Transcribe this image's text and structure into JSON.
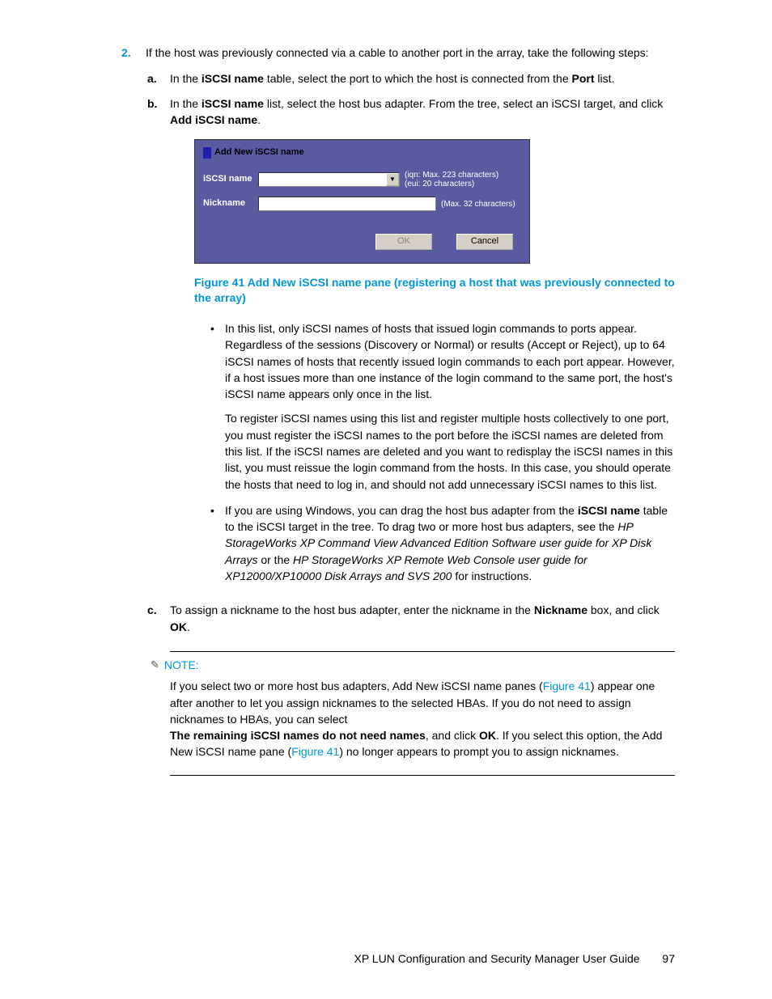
{
  "step2": {
    "num": "2.",
    "intro_a": "If the host was previously connected via a cable to another port in the array, take the following steps:",
    "a": {
      "letter": "a.",
      "t1": "In the ",
      "b1": "iSCSI name",
      "t2": " table, select the port to which the host is connected from the ",
      "b2": "Port",
      "t3": " list."
    },
    "b": {
      "letter": "b.",
      "t1": "In the ",
      "b1": "iSCSI name",
      "t2": " list, select the host bus adapter. From the tree, select an iSCSI target, and click ",
      "b2": "Add iSCSI name",
      "t3": "."
    },
    "c": {
      "letter": "c.",
      "t1": "To assign a nickname to the host bus adapter, enter the nickname in the ",
      "b1": "Nickname",
      "t2": " box, and click ",
      "b2": "OK",
      "t3": "."
    }
  },
  "dialog": {
    "title": "Add New iSCSI name",
    "label_iscsi": "iSCSI name",
    "hint_iscsi_line1": "(iqn: Max. 223 characters)",
    "hint_iscsi_line2": "(eui: 20 characters)",
    "label_nick": "Nickname",
    "hint_nick": "(Max. 32 characters)",
    "btn_ok": "OK",
    "btn_cancel": "Cancel"
  },
  "figcap": "Figure 41 Add New iSCSI name pane (registering a host that was previously connected to the array)",
  "bullets": {
    "b1p1": "In this list, only iSCSI names of hosts that issued login commands to ports appear. Regardless of the sessions (Discovery or Normal) or results (Accept or Reject), up to 64 iSCSI names of hosts that recently issued login commands to each port appear. However, if a host issues more than one instance of the login command to the same port, the host's iSCSI name appears only once in the list.",
    "b1p2": "To register iSCSI names using this list and register multiple hosts collectively to one port, you must register the iSCSI names to the port before the iSCSI names are deleted from this list. If the iSCSI names are deleted and you want to redisplay the iSCSI names in this list, you must reissue the login command from the hosts. In this case, you should operate the hosts that need to log in, and should not add unnecessary iSCSI names to this list.",
    "b2": {
      "t1": "If you are using Windows, you can drag the host bus adapter from the ",
      "b1": "iSCSI name",
      "t2": " table to the iSCSI target in the tree. To drag two or more host bus adapters, see the ",
      "i1": "HP StorageWorks XP Command View Advanced Edition Software user guide for XP Disk Arrays",
      "t3": " or the ",
      "i2": "HP StorageWorks XP Remote Web Console user guide for XP12000/XP10000 Disk Arrays and SVS 200",
      "t4": " for instructions."
    }
  },
  "note": {
    "head": "NOTE:",
    "p1a": "If you select two or more host bus adapters, Add New iSCSI name panes (",
    "fig1": "Figure 41",
    "p1b": ") appear one after another to let you assign nicknames to the selected HBAs. If you do not need to assign nicknames to HBAs, you can select",
    "bold1": "The remaining iSCSI names do not need names",
    "p2a": ", and click ",
    "bold2": "OK",
    "p2b": ". If you select this option, the Add New iSCSI name pane (",
    "fig2": "Figure 41",
    "p2c": ") no longer appears to prompt you to assign nicknames."
  },
  "footer": {
    "title": "XP LUN Configuration and Security Manager User Guide",
    "page": "97"
  }
}
